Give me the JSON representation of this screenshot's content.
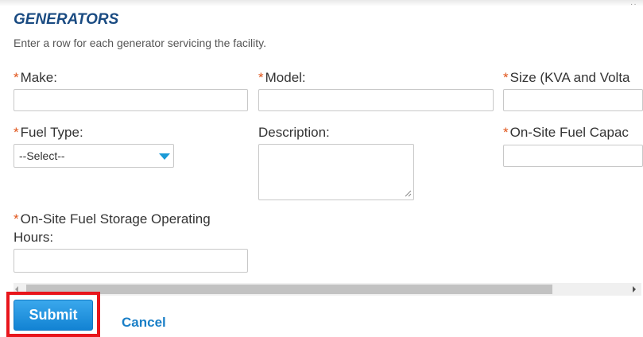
{
  "section": {
    "title": "GENERATORS",
    "subtitle": "Enter a row for each generator servicing the facility."
  },
  "fields": {
    "make": {
      "required_mark": "*",
      "label": "Make:",
      "value": ""
    },
    "model": {
      "required_mark": "*",
      "label": "Model:",
      "value": ""
    },
    "size": {
      "required_mark": "*",
      "label": "Size (KVA and Volta",
      "value": ""
    },
    "fuel_type": {
      "required_mark": "*",
      "label": "Fuel Type:",
      "selected": "--Select--"
    },
    "description": {
      "label": "Description:",
      "value": ""
    },
    "onsite_capacity": {
      "required_mark": "*",
      "label": "On-Site Fuel Capac",
      "value": ""
    },
    "operating_hours": {
      "required_mark": "*",
      "label_line1": "On-Site Fuel Storage Operating",
      "label_line2": "Hours:",
      "value": ""
    }
  },
  "actions": {
    "submit_label": "Submit",
    "cancel_label": "Cancel"
  },
  "colors": {
    "title": "#1a4b82",
    "required": "#e0541a",
    "accent": "#1a9ad6",
    "submit_bg": "#1e8fe0",
    "highlight": "#e8151b",
    "link": "#1a7fc7"
  },
  "icons": {
    "dropdown": "caret-down-icon",
    "resize": "resize-grip-icon",
    "scroll_left": "scroll-left-arrow-icon",
    "scroll_right": "scroll-right-arrow-icon"
  }
}
